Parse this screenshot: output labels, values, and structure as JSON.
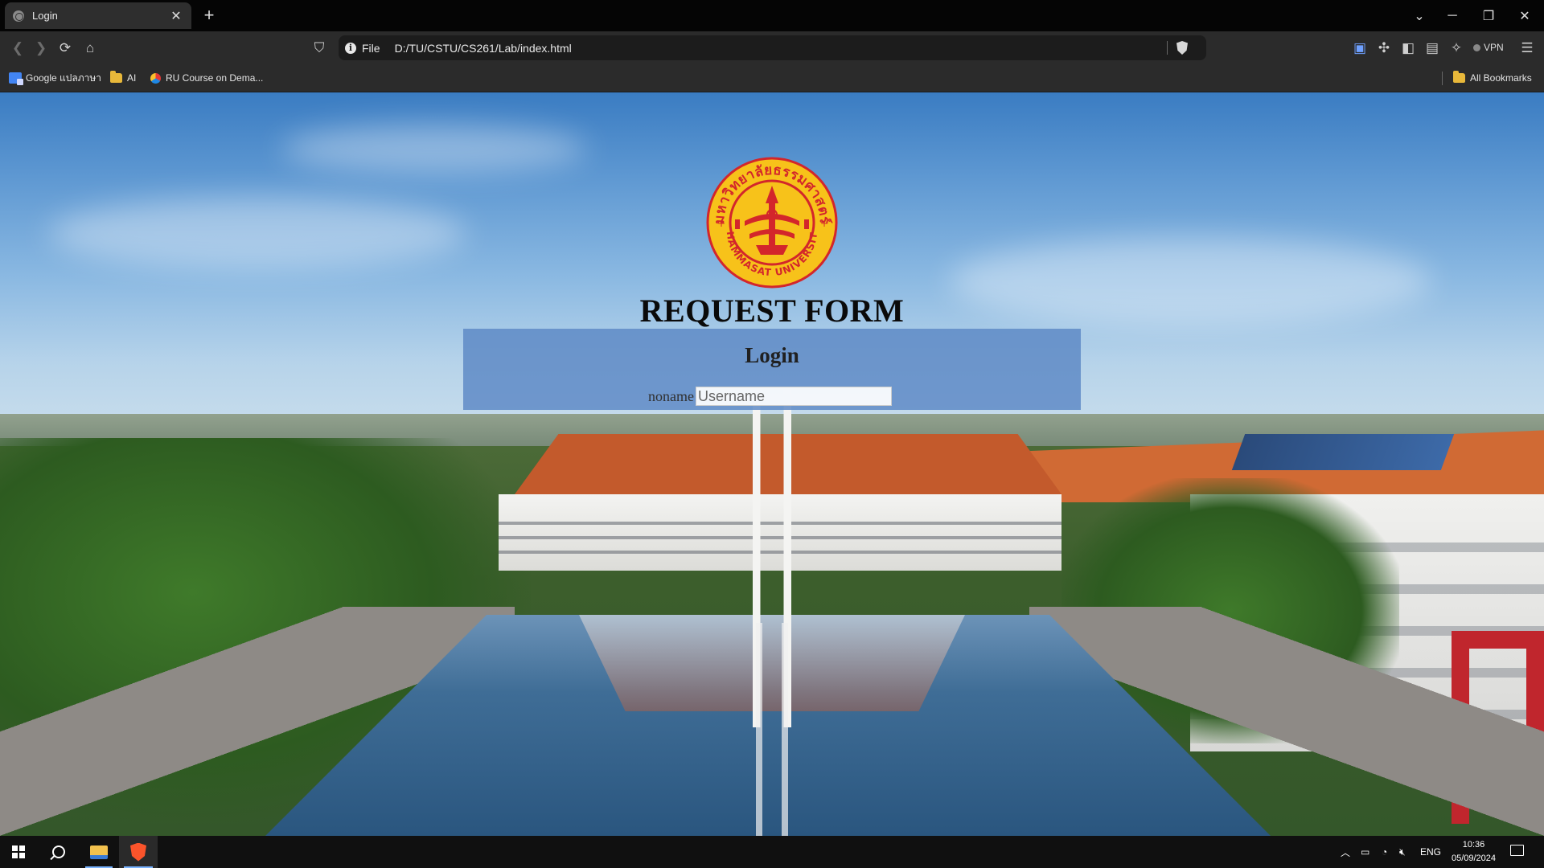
{
  "browser": {
    "tab_title": "Login",
    "tab_close": "✕",
    "new_tab": "+",
    "url_scheme": "File",
    "url": "D:/TU/CSTU/CS261/Lab/index.html",
    "vpn_label": "VPN",
    "bookmarks": [
      {
        "label": "Google แปลภาษา",
        "icon": "google-translate-icon"
      },
      {
        "label": "AI",
        "icon": "folder-icon"
      },
      {
        "label": "RU Course on Dema...",
        "icon": "ru-course-icon"
      }
    ],
    "all_bookmarks": "All Bookmarks"
  },
  "page": {
    "seal_top_text": "มหาวิทยาลัยธรรมศาสตร์",
    "seal_bottom_text": "THAMMASAT UNIVERSITY",
    "form_title": "REQUEST FORM",
    "login_title": "Login",
    "username_label": "noname",
    "username_placeholder": "Username",
    "username_value": ""
  },
  "taskbar": {
    "lang": "ENG",
    "time": "10:36",
    "date": "05/09/2024"
  },
  "colors": {
    "login_panel": "#5b88c4",
    "seal_gold": "#f7c21a",
    "seal_red": "#d3262b",
    "taskbar": "#101010"
  }
}
